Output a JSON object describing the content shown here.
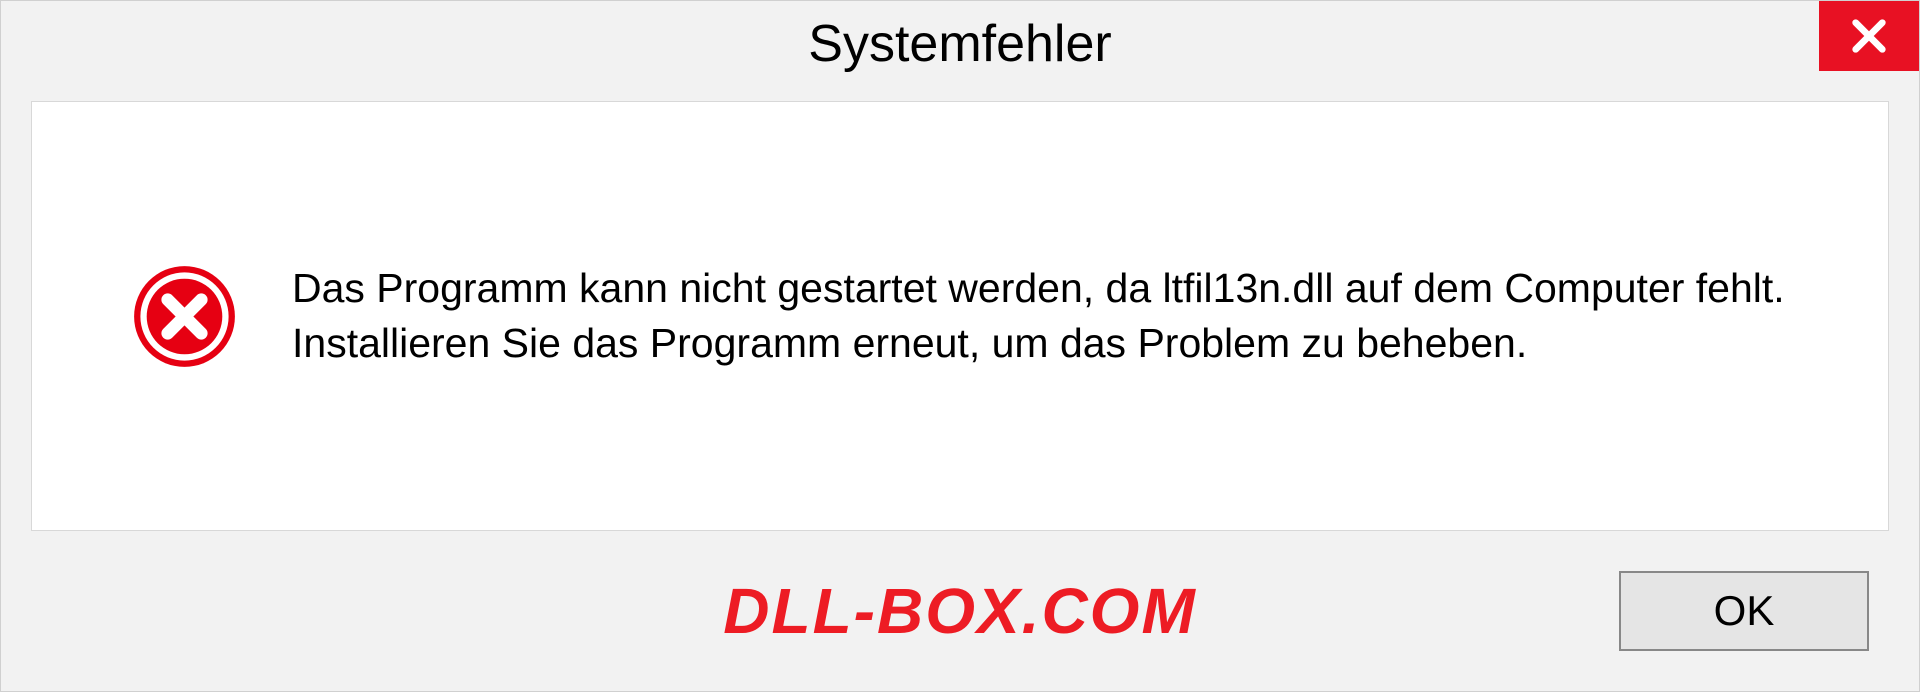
{
  "dialog": {
    "title": "Systemfehler",
    "message": "Das Programm kann nicht gestartet werden, da ltfil13n.dll auf dem Computer fehlt. Installieren Sie das Programm erneut, um das Problem zu beheben.",
    "ok_label": "OK"
  },
  "watermark": "DLL-BOX.COM",
  "colors": {
    "close_bg": "#e81123",
    "error_circle": "#e60012",
    "watermark": "#ed1c24"
  },
  "icons": {
    "close": "close-icon",
    "error": "error-circle-x-icon"
  }
}
